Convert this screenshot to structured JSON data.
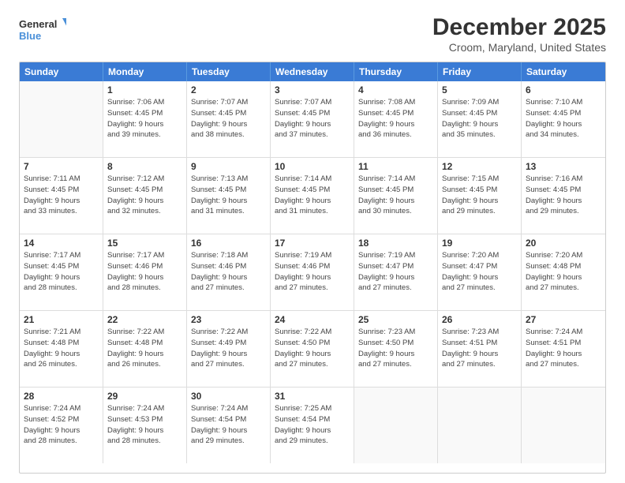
{
  "logo": {
    "line1": "General",
    "line2": "Blue"
  },
  "title": "December 2025",
  "subtitle": "Croom, Maryland, United States",
  "header_days": [
    "Sunday",
    "Monday",
    "Tuesday",
    "Wednesday",
    "Thursday",
    "Friday",
    "Saturday"
  ],
  "weeks": [
    [
      {
        "day": "",
        "info": ""
      },
      {
        "day": "1",
        "info": "Sunrise: 7:06 AM\nSunset: 4:45 PM\nDaylight: 9 hours\nand 39 minutes."
      },
      {
        "day": "2",
        "info": "Sunrise: 7:07 AM\nSunset: 4:45 PM\nDaylight: 9 hours\nand 38 minutes."
      },
      {
        "day": "3",
        "info": "Sunrise: 7:07 AM\nSunset: 4:45 PM\nDaylight: 9 hours\nand 37 minutes."
      },
      {
        "day": "4",
        "info": "Sunrise: 7:08 AM\nSunset: 4:45 PM\nDaylight: 9 hours\nand 36 minutes."
      },
      {
        "day": "5",
        "info": "Sunrise: 7:09 AM\nSunset: 4:45 PM\nDaylight: 9 hours\nand 35 minutes."
      },
      {
        "day": "6",
        "info": "Sunrise: 7:10 AM\nSunset: 4:45 PM\nDaylight: 9 hours\nand 34 minutes."
      }
    ],
    [
      {
        "day": "7",
        "info": "Sunrise: 7:11 AM\nSunset: 4:45 PM\nDaylight: 9 hours\nand 33 minutes."
      },
      {
        "day": "8",
        "info": "Sunrise: 7:12 AM\nSunset: 4:45 PM\nDaylight: 9 hours\nand 32 minutes."
      },
      {
        "day": "9",
        "info": "Sunrise: 7:13 AM\nSunset: 4:45 PM\nDaylight: 9 hours\nand 31 minutes."
      },
      {
        "day": "10",
        "info": "Sunrise: 7:14 AM\nSunset: 4:45 PM\nDaylight: 9 hours\nand 31 minutes."
      },
      {
        "day": "11",
        "info": "Sunrise: 7:14 AM\nSunset: 4:45 PM\nDaylight: 9 hours\nand 30 minutes."
      },
      {
        "day": "12",
        "info": "Sunrise: 7:15 AM\nSunset: 4:45 PM\nDaylight: 9 hours\nand 29 minutes."
      },
      {
        "day": "13",
        "info": "Sunrise: 7:16 AM\nSunset: 4:45 PM\nDaylight: 9 hours\nand 29 minutes."
      }
    ],
    [
      {
        "day": "14",
        "info": "Sunrise: 7:17 AM\nSunset: 4:45 PM\nDaylight: 9 hours\nand 28 minutes."
      },
      {
        "day": "15",
        "info": "Sunrise: 7:17 AM\nSunset: 4:46 PM\nDaylight: 9 hours\nand 28 minutes."
      },
      {
        "day": "16",
        "info": "Sunrise: 7:18 AM\nSunset: 4:46 PM\nDaylight: 9 hours\nand 27 minutes."
      },
      {
        "day": "17",
        "info": "Sunrise: 7:19 AM\nSunset: 4:46 PM\nDaylight: 9 hours\nand 27 minutes."
      },
      {
        "day": "18",
        "info": "Sunrise: 7:19 AM\nSunset: 4:47 PM\nDaylight: 9 hours\nand 27 minutes."
      },
      {
        "day": "19",
        "info": "Sunrise: 7:20 AM\nSunset: 4:47 PM\nDaylight: 9 hours\nand 27 minutes."
      },
      {
        "day": "20",
        "info": "Sunrise: 7:20 AM\nSunset: 4:48 PM\nDaylight: 9 hours\nand 27 minutes."
      }
    ],
    [
      {
        "day": "21",
        "info": "Sunrise: 7:21 AM\nSunset: 4:48 PM\nDaylight: 9 hours\nand 26 minutes."
      },
      {
        "day": "22",
        "info": "Sunrise: 7:22 AM\nSunset: 4:48 PM\nDaylight: 9 hours\nand 26 minutes."
      },
      {
        "day": "23",
        "info": "Sunrise: 7:22 AM\nSunset: 4:49 PM\nDaylight: 9 hours\nand 27 minutes."
      },
      {
        "day": "24",
        "info": "Sunrise: 7:22 AM\nSunset: 4:50 PM\nDaylight: 9 hours\nand 27 minutes."
      },
      {
        "day": "25",
        "info": "Sunrise: 7:23 AM\nSunset: 4:50 PM\nDaylight: 9 hours\nand 27 minutes."
      },
      {
        "day": "26",
        "info": "Sunrise: 7:23 AM\nSunset: 4:51 PM\nDaylight: 9 hours\nand 27 minutes."
      },
      {
        "day": "27",
        "info": "Sunrise: 7:24 AM\nSunset: 4:51 PM\nDaylight: 9 hours\nand 27 minutes."
      }
    ],
    [
      {
        "day": "28",
        "info": "Sunrise: 7:24 AM\nSunset: 4:52 PM\nDaylight: 9 hours\nand 28 minutes."
      },
      {
        "day": "29",
        "info": "Sunrise: 7:24 AM\nSunset: 4:53 PM\nDaylight: 9 hours\nand 28 minutes."
      },
      {
        "day": "30",
        "info": "Sunrise: 7:24 AM\nSunset: 4:54 PM\nDaylight: 9 hours\nand 29 minutes."
      },
      {
        "day": "31",
        "info": "Sunrise: 7:25 AM\nSunset: 4:54 PM\nDaylight: 9 hours\nand 29 minutes."
      },
      {
        "day": "",
        "info": ""
      },
      {
        "day": "",
        "info": ""
      },
      {
        "day": "",
        "info": ""
      }
    ]
  ]
}
